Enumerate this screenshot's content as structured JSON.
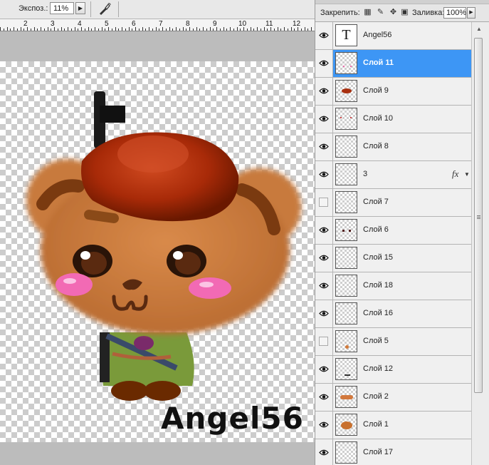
{
  "options_bar": {
    "exposure_label": "Экспоз.:",
    "exposure_value": "11%",
    "airbrush_icon": "airbrush-icon"
  },
  "ruler": {
    "ticks": [
      "2",
      "3",
      "4",
      "5",
      "6",
      "7",
      "8",
      "9",
      "10",
      "11",
      "12"
    ]
  },
  "canvas": {
    "watermark": "Angel56"
  },
  "layers_panel": {
    "lock_label": "Закрепить:",
    "fill_label": "Заливка:",
    "fill_value": "100%",
    "layers": [
      {
        "name": "Angel56",
        "visible": true,
        "selected": false,
        "kind": "text",
        "thumb": "T"
      },
      {
        "name": "Слой 11",
        "visible": true,
        "selected": true,
        "kind": "pixel"
      },
      {
        "name": "Слой 9",
        "visible": true,
        "selected": false,
        "kind": "pixel"
      },
      {
        "name": "Слой 10",
        "visible": true,
        "selected": false,
        "kind": "pixel"
      },
      {
        "name": "Слой 8",
        "visible": true,
        "selected": false,
        "kind": "pixel"
      },
      {
        "name": "3",
        "visible": true,
        "selected": false,
        "kind": "pixel",
        "fx": "fx"
      },
      {
        "name": "Слой 7",
        "visible": false,
        "selected": false,
        "kind": "pixel"
      },
      {
        "name": "Слой 6",
        "visible": true,
        "selected": false,
        "kind": "pixel"
      },
      {
        "name": "Слой 15",
        "visible": true,
        "selected": false,
        "kind": "pixel"
      },
      {
        "name": "Слой 18",
        "visible": true,
        "selected": false,
        "kind": "pixel"
      },
      {
        "name": "Слой 16",
        "visible": true,
        "selected": false,
        "kind": "pixel"
      },
      {
        "name": "Слой 5",
        "visible": false,
        "selected": false,
        "kind": "pixel"
      },
      {
        "name": "Слой 12",
        "visible": true,
        "selected": false,
        "kind": "pixel"
      },
      {
        "name": "Слой 2",
        "visible": true,
        "selected": false,
        "kind": "pixel"
      },
      {
        "name": "Слой 1",
        "visible": true,
        "selected": false,
        "kind": "pixel"
      },
      {
        "name": "Слой 17",
        "visible": true,
        "selected": false,
        "kind": "pixel"
      }
    ]
  },
  "colors": {
    "selection": "#3d96f5",
    "bear_fur": "#c87a3c",
    "beret": "#a82a08",
    "jacket": "#7a9a3a"
  }
}
